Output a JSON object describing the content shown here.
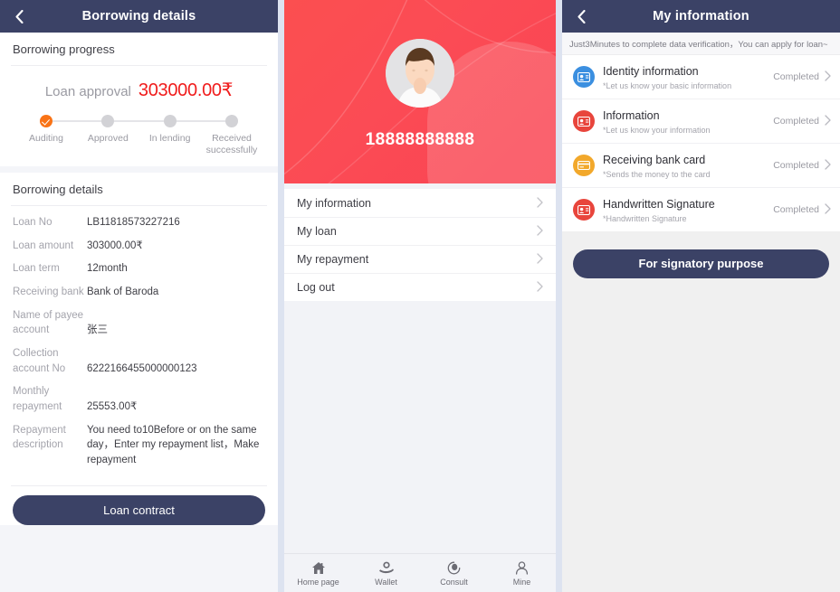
{
  "left": {
    "navbar": {
      "title": "Borrowing details",
      "back_icon": "chevron-left-icon"
    },
    "progress_section_title": "Borrowing progress",
    "approval": {
      "label": "Loan approval",
      "amount": "303000.00₹",
      "amount_color": "#f01c1c"
    },
    "steps": [
      {
        "label": "Auditing",
        "state": "done"
      },
      {
        "label": "Approved",
        "state": "pending"
      },
      {
        "label": "In lending",
        "state": "pending"
      },
      {
        "label": "Received successfully",
        "state": "pending"
      }
    ],
    "details_section_title": "Borrowing details",
    "details": [
      {
        "key": "Loan No",
        "value": "LB11818573227216"
      },
      {
        "key": "Loan amount",
        "value": "303000.00₹"
      },
      {
        "key": "Loan term",
        "value": "12month"
      },
      {
        "key": "Receiving bank",
        "value": "Bank of Baroda"
      },
      {
        "key": "Name of payee account",
        "value": "张三"
      },
      {
        "key": "Collection account No",
        "value": "6222166455000000123"
      },
      {
        "key": "Monthly repayment",
        "value": "25553.00₹"
      },
      {
        "key": "Repayment description",
        "value": "You need to10Before or on the same day，Enter my repayment list，Make repayment"
      }
    ],
    "contract_button": "Loan contract"
  },
  "middle": {
    "avatar_icon": "user-avatar-icon",
    "phone_number": "18888888888",
    "menu": [
      {
        "label": "My information",
        "chevron": "chevron-right-icon"
      },
      {
        "label": "My loan",
        "chevron": "chevron-right-icon"
      },
      {
        "label": "My repayment",
        "chevron": "chevron-right-icon"
      },
      {
        "label": "Log out",
        "chevron": "chevron-right-icon"
      }
    ],
    "tabs": [
      {
        "label": "Home page",
        "icon": "home-icon"
      },
      {
        "label": "Wallet",
        "icon": "wallet-hand-coin-icon"
      },
      {
        "label": "Consult",
        "icon": "headset-consult-icon"
      },
      {
        "label": "Mine",
        "icon": "person-outline-icon"
      }
    ]
  },
  "right": {
    "navbar": {
      "title": "My information",
      "back_icon": "chevron-left-icon"
    },
    "notice": "Just3Minutes to complete data verification，You can apply for loan~",
    "items": [
      {
        "title": "Identity information",
        "subtitle": "*Let us know your basic information",
        "status": "Completed",
        "icon": "id-card-icon",
        "icon_color": "#3b8fe0",
        "chevron": "chevron-right-icon"
      },
      {
        "title": "Information",
        "subtitle": "*Let us know your information",
        "status": "Completed",
        "icon": "id-card-icon",
        "icon_color": "#e8453c",
        "chevron": "chevron-right-icon"
      },
      {
        "title": "Receiving bank card",
        "subtitle": "*Sends the money to the card",
        "status": "Completed",
        "icon": "bank-card-icon",
        "icon_color": "#f2a82b",
        "chevron": "chevron-right-icon"
      },
      {
        "title": "Handwritten Signature",
        "subtitle": "*Handwritten Signature",
        "status": "Completed",
        "icon": "id-card-icon",
        "icon_color": "#e8453c",
        "chevron": "chevron-right-icon"
      }
    ],
    "signatory_button": "For signatory purpose"
  }
}
